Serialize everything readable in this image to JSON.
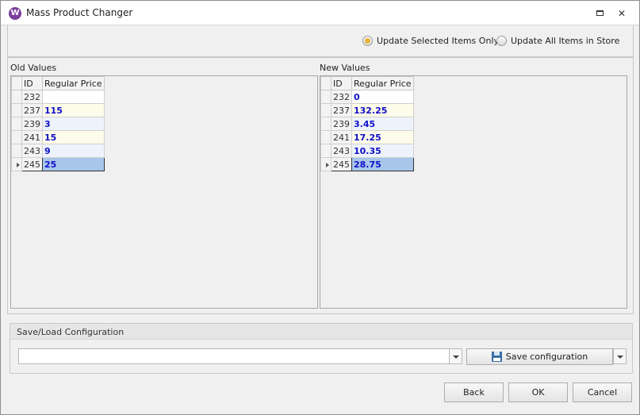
{
  "window": {
    "title": "Mass Product Changer",
    "icon_letter": "W",
    "accent_color": "#7a3e9d"
  },
  "mode": {
    "options": [
      {
        "label": "Update Selected Items Only",
        "checked": true
      },
      {
        "label": "Update All Items in Store",
        "checked": false
      }
    ]
  },
  "old_values": {
    "label": "Old Values",
    "columns": [
      "ID",
      "Regular Price"
    ],
    "rows": [
      {
        "id": "232",
        "price": ""
      },
      {
        "id": "237",
        "price": "115"
      },
      {
        "id": "239",
        "price": "3"
      },
      {
        "id": "241",
        "price": "15"
      },
      {
        "id": "243",
        "price": "9"
      },
      {
        "id": "245",
        "price": "25"
      }
    ]
  },
  "new_values": {
    "label": "New Values",
    "columns": [
      "ID",
      "Regular Price"
    ],
    "rows": [
      {
        "id": "232",
        "price": "0"
      },
      {
        "id": "237",
        "price": "132.25"
      },
      {
        "id": "239",
        "price": "3.45"
      },
      {
        "id": "241",
        "price": "17.25"
      },
      {
        "id": "243",
        "price": "10.35"
      },
      {
        "id": "245",
        "price": "28.75"
      }
    ]
  },
  "config": {
    "title": "Save/Load Configuration",
    "input_value": "",
    "save_label": "Save configuration"
  },
  "footer": {
    "back_label": "Back",
    "ok_label": "OK",
    "cancel_label": "Cancel"
  }
}
